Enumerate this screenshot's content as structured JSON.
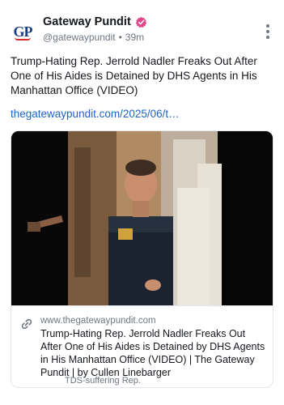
{
  "post": {
    "author": {
      "name": "Gateway Pundit",
      "avatar_initials": "GP",
      "handle": "@gatewaypundit",
      "separator": "•",
      "time": "39m"
    },
    "text": "Trump-Hating Rep. Jerrold Nadler Freaks Out After One of His Aides is Detained by DHS Agents in His Manhattan Office (VIDEO)",
    "link_text": "thegatewaypundit.com/2025/06/t…",
    "link_card": {
      "domain": "www.thegatewaypundit.com",
      "title": "Trump-Hating Rep. Jerrold Nadler Freaks Out After One of His Aides is Detained by DHS Agents in His Manhattan Office (VIDEO) | The Gateway Pundit | by Cullen Linebarger",
      "tag": "TDS-suffering Rep."
    }
  },
  "icons": {
    "verified": "verified-badge-icon",
    "more": "more-options-icon",
    "link": "link-icon"
  },
  "colors": {
    "link": "#1f62c8",
    "verified_badge": "#e0488b",
    "muted_text": "#6f7780",
    "avatar_text": "#1d3c86"
  }
}
